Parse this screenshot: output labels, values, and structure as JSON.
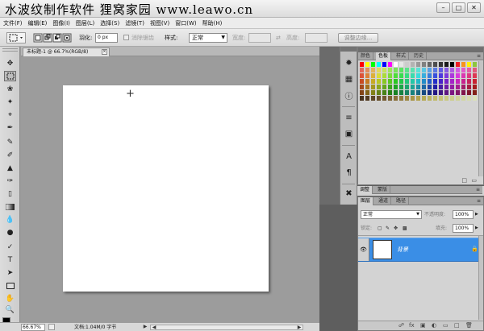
{
  "window": {
    "title": "水波纹制作软件  狸窝家园  www.leawo.cn",
    "controls": [
      "–",
      "□",
      "✕"
    ]
  },
  "menu": {
    "items": [
      "文件(F)",
      "编辑(E)",
      "图像(I)",
      "图层(L)",
      "选择(S)",
      "滤镜(T)",
      "视图(V)",
      "窗口(W)",
      "帮助(H)"
    ]
  },
  "options": {
    "feather_label": "羽化:",
    "feather_value": "0 px",
    "antialias_label": "消除锯齿",
    "style_label": "样式:",
    "style_value": "正常",
    "width_label": "宽度:",
    "height_label": "高度:",
    "refine_edge_button": "调整边缘..."
  },
  "document": {
    "tab_title": "未标题-1 @ 66.7%(RGB/8)",
    "tab_close": "×"
  },
  "status": {
    "zoom": "66.67%",
    "doc_info": "文档:1.04M/0 字节"
  },
  "swatches_panel": {
    "tabs": [
      "颜色",
      "色板",
      "样式",
      "历史"
    ],
    "active_tab": "色板"
  },
  "adjust_panel": {
    "tabs": [
      "调整",
      "蒙版"
    ]
  },
  "layers_panel": {
    "tabs": [
      "图层",
      "通道",
      "路径"
    ],
    "blend_mode": "正常",
    "opacity_label": "不透明度:",
    "opacity_value": "100%",
    "lock_label": "锁定:",
    "fill_label": "填充:",
    "fill_value": "100%",
    "layer_name": "背景"
  },
  "colors": {
    "accent": "#3a8ee6",
    "panel_bg": "#d3d3d3",
    "dock_bg": "#5e5e5e",
    "workspace_bg": "#9c9c9c"
  },
  "icons": {
    "toolbox": [
      "move-icon",
      "marquee-icon",
      "lasso-icon",
      "magic-wand-icon",
      "crop-icon",
      "eyedropper-icon",
      "healing-brush-icon",
      "brush-icon",
      "clone-stamp-icon",
      "history-brush-icon",
      "eraser-icon",
      "gradient-icon",
      "blur-icon",
      "dodge-icon",
      "pen-icon",
      "type-icon",
      "path-selection-icon",
      "shape-icon",
      "hand-icon",
      "zoom-icon"
    ],
    "dock_strip": [
      "color-icon",
      "swatches-icon",
      "info-icon",
      "brushes-icon",
      "clone-source-icon",
      "character-icon",
      "paragraph-icon",
      "tools-presets-icon"
    ]
  }
}
